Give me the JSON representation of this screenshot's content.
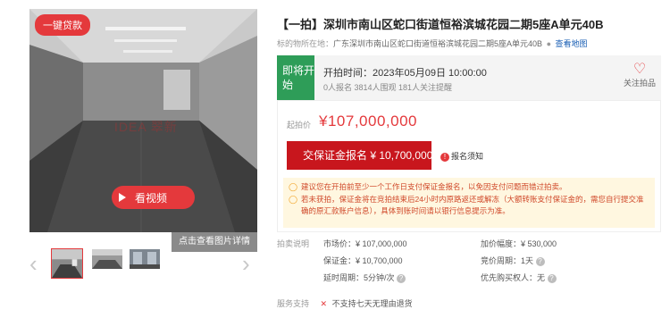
{
  "gallery": {
    "badge": "一键贷款",
    "watermark": "IDEA 翠新",
    "video_label": "看视频",
    "detail_label": "点击查看图片详情",
    "prev_icon": "chevron-left-icon",
    "next_icon": "chevron-right-icon"
  },
  "listing": {
    "title": "【一拍】深圳市南山区蛇口街道恒裕滨城花园二期5座A单元40B",
    "location_label": "标的物所在地：",
    "location_value": "广东深圳市南山区蛇口街道恒裕滨城花园二期5座A单元40B",
    "map_link": "查看地图"
  },
  "status": {
    "tag": "即将开始",
    "start_label": "开拍时间：",
    "start_time": "2023年05月09日 10:00:00",
    "stats": "0人报名  3814人围观  181人关注提醒",
    "follow_label": "关注拍品"
  },
  "price": {
    "start_label": "起拍价",
    "start_value": "¥107,000,000",
    "deposit_button": "交保证金报名 ¥ 10,700,000",
    "notice_label": "报名须知",
    "tips": [
      "建议您在开拍前至少一个工作日支付保证金报名，以免因支付问题而错过拍卖。",
      "若未获拍，保证金将在竞拍结束后24小时内原路返还或解冻（大额转账支付保证金的，需您自行提交准确的原汇款账户信息），具体到账时间请以银行信息提示为准。"
    ]
  },
  "rules": {
    "label": "拍卖说明",
    "market_price": "市场价：¥ 107,000,000",
    "increment": "加价幅度：¥ 530,000",
    "deposit": "保证金：¥ 10,700,000",
    "bid_period": "竞价周期：1天",
    "delay": "延时周期：5分钟/次",
    "priority": "优先购买权人：无"
  },
  "service": {
    "label": "服务支持",
    "value": "不支持七天无理由退货"
  },
  "colors": {
    "accent_red": "#e4393c",
    "status_green": "#2e9d58",
    "tips_bg": "#fff7e0"
  }
}
